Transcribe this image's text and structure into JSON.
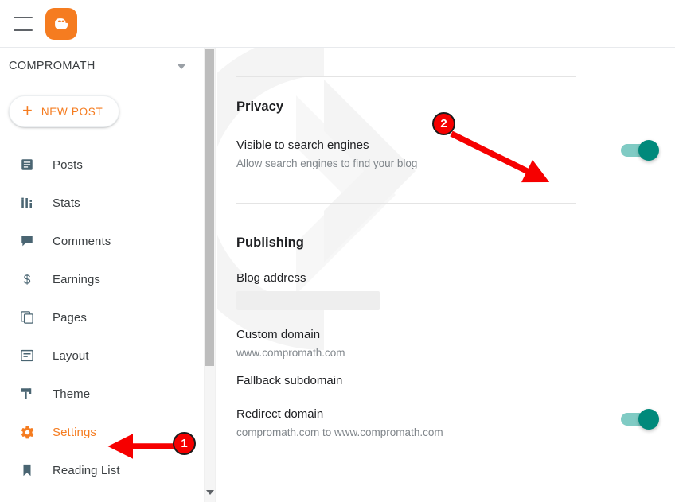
{
  "topbar": {
    "menu_icon": "hamburger-menu-icon",
    "logo_icon": "blogger-logo-icon",
    "logo_color": "#f57c20"
  },
  "sidebar": {
    "blog_name": "COMPROMATH",
    "blog_selector_icon": "chevron-down-icon",
    "new_post_label": "NEW POST",
    "new_post_icon": "plus-icon",
    "accent_color": "#f57c20",
    "items": [
      {
        "label": "Posts",
        "icon": "posts-icon",
        "active": false
      },
      {
        "label": "Stats",
        "icon": "stats-icon",
        "active": false
      },
      {
        "label": "Comments",
        "icon": "comments-icon",
        "active": false
      },
      {
        "label": "Earnings",
        "icon": "earnings-dollar-icon",
        "active": false
      },
      {
        "label": "Pages",
        "icon": "pages-icon",
        "active": false
      },
      {
        "label": "Layout",
        "icon": "layout-icon",
        "active": false
      },
      {
        "label": "Theme",
        "icon": "theme-brush-icon",
        "active": false
      },
      {
        "label": "Settings",
        "icon": "settings-gear-icon",
        "active": true
      },
      {
        "label": "Reading List",
        "icon": "reading-list-bookmark-icon",
        "active": false
      }
    ],
    "scroll_down_icon": "scroll-down-arrow-icon"
  },
  "main": {
    "privacy": {
      "heading": "Privacy",
      "rows": [
        {
          "label": "Visible to search engines",
          "sublabel": "Allow search engines to find your blog",
          "toggle": "on"
        }
      ]
    },
    "publishing": {
      "heading": "Publishing",
      "rows": [
        {
          "label": "Blog address",
          "sublabel": "",
          "redacted": true,
          "toggle": "none"
        },
        {
          "label": "Custom domain",
          "sublabel": "www.compromath.com",
          "redacted": false,
          "toggle": "none"
        },
        {
          "label": "Fallback subdomain",
          "sublabel": "",
          "redacted": false,
          "toggle": "none"
        },
        {
          "label": "Redirect domain",
          "sublabel": "compromath.com to www.compromath.com",
          "redacted": false,
          "toggle": "on"
        }
      ]
    },
    "toggle_on_track_color": "#80cbc4",
    "toggle_on_thumb_color": "#00897b"
  },
  "annotations": {
    "color": "#f60000",
    "markers": [
      {
        "number": "1",
        "points_to": "sidebar-item-settings"
      },
      {
        "number": "2",
        "points_to": "visible-to-search-engines-toggle"
      }
    ]
  }
}
